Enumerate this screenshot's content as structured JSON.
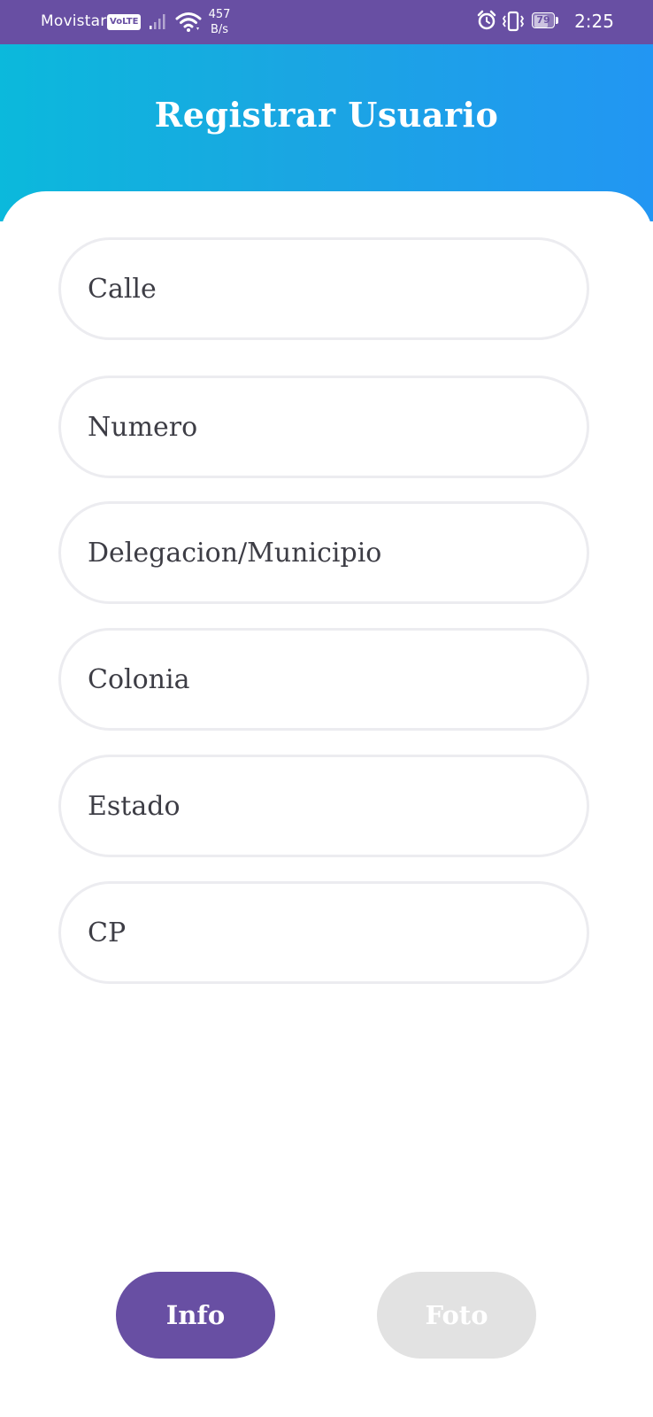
{
  "status_bar": {
    "carrier": "Movistar",
    "volte": "VoLTE",
    "net_speed_value": "457",
    "net_speed_unit": "B/s",
    "battery_percent": "79",
    "battery_level": 0.79,
    "time": "2:25",
    "icons": [
      "signal-icon",
      "wifi-icon",
      "alarm-icon",
      "vibrate-icon",
      "battery-icon"
    ]
  },
  "header": {
    "title": "Registrar Usuario"
  },
  "form": {
    "fields": [
      {
        "label": "Calle"
      },
      {
        "label": "Numero"
      },
      {
        "label": "Delegacion/Municipio"
      },
      {
        "label": "Colonia"
      },
      {
        "label": "Estado"
      },
      {
        "label": "CP"
      }
    ]
  },
  "tabs": {
    "info_label": "Info",
    "foto_label": "Foto"
  },
  "colors": {
    "status_bar": "#684fa3",
    "header_gradient_start": "#0bb9dc",
    "header_gradient_end": "#2296f3",
    "field_border": "#ececf0",
    "field_text": "#3d3d45",
    "tab_active": "#684fa3",
    "tab_inactive": "#e2e2e2"
  }
}
